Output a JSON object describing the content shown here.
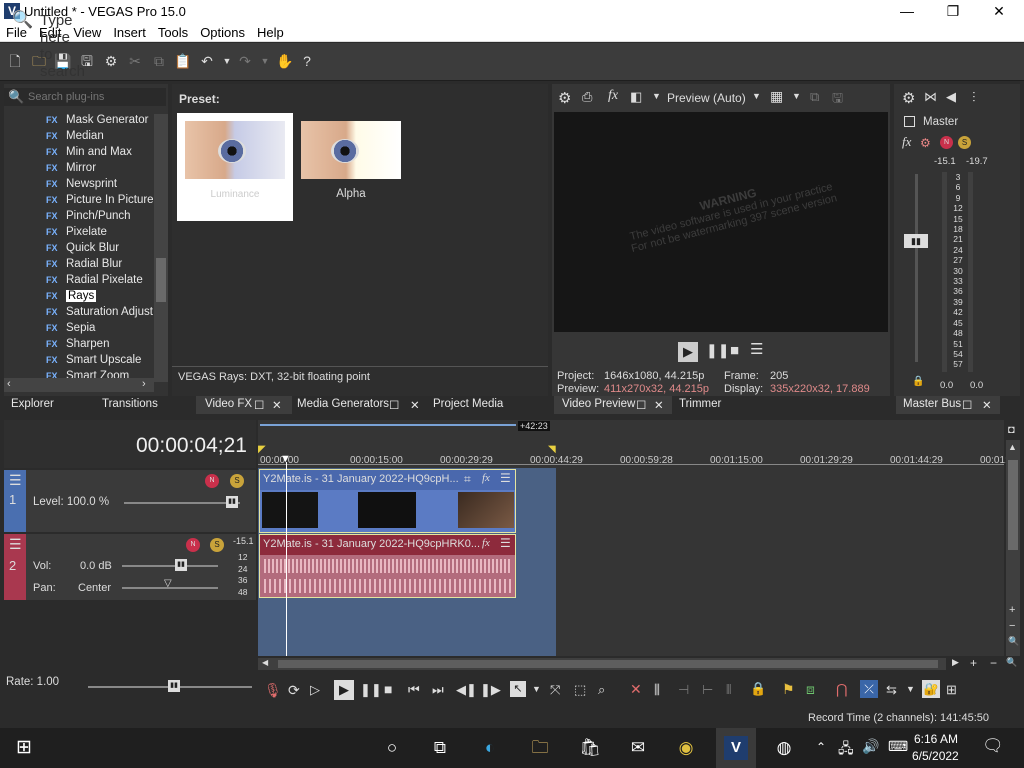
{
  "window": {
    "title": "Untitled * - VEGAS Pro 15.0",
    "logo_letter": "V",
    "minimize": "—",
    "maximize": "❐",
    "close": "✕"
  },
  "menu": [
    "File",
    "Edit",
    "View",
    "Insert",
    "Tools",
    "Options",
    "Help"
  ],
  "plugins": {
    "search_placeholder": "Search plug-ins",
    "items": [
      "Mask Generator",
      "Median",
      "Min and Max",
      "Mirror",
      "Newsprint",
      "Picture In Picture",
      "Pinch/Punch",
      "Pixelate",
      "Quick Blur",
      "Radial Blur",
      "Radial Pixelate",
      "Rays",
      "Saturation Adjust",
      "Sepia",
      "Sharpen",
      "Smart Upscale",
      "Smart Zoom"
    ],
    "selected": "Rays",
    "fx_tag": "FX"
  },
  "preset": {
    "header": "Preset:",
    "items": [
      "Luminance",
      "Alpha"
    ],
    "description": "VEGAS Rays: DXT, 32-bit floating point"
  },
  "preview": {
    "quality": "Preview (Auto)",
    "watermark_title": "WARNING",
    "watermark_line1": "The video software is used in your practice",
    "watermark_line2": "For not be watermarking 397 scene version",
    "project_label": "Project:",
    "project_value": "1646x1080, 44.215p",
    "frame_label": "Frame:",
    "frame_value": "205",
    "preview_label": "Preview:",
    "preview_value": "411x270x32, 44.215p",
    "display_label": "Display:",
    "display_value": "335x220x32, 17.889"
  },
  "master": {
    "label": "Master",
    "peak_left": "-15.1",
    "peak_right": "-19.7",
    "scale": [
      "3",
      "6",
      "9",
      "12",
      "15",
      "18",
      "21",
      "24",
      "27",
      "30",
      "33",
      "36",
      "39",
      "42",
      "45",
      "48",
      "51",
      "54",
      "57"
    ],
    "bottom_left": "0.0",
    "bottom_right": "0.0"
  },
  "tabs": {
    "explorer": "Explorer",
    "transitions": "Transitions",
    "video_fx": "Video FX",
    "media_generators": "Media Generators",
    "project_media": "Project Media",
    "video_preview": "Video Preview",
    "trimmer": "Trimmer",
    "master_bus": "Master Bus"
  },
  "timeline": {
    "timecode": "00:00:04;21",
    "offset_badge": "+42:23",
    "ruler": [
      "00:00:00",
      "00:00:15:00",
      "00:00:29:29",
      "00:00:44:29",
      "00:00:59:28",
      "00:01:15:00",
      "00:01:29:29",
      "00:01:44:29",
      "00:01:"
    ],
    "video_track": {
      "number": "1",
      "level": "Level: 100.0 %",
      "clip_title": "Y2Mate.is - 31 January 2022-HQ9cpH..."
    },
    "audio_track": {
      "number": "2",
      "vol_label": "Vol:",
      "vol_value": "0.0 dB",
      "pan_label": "Pan:",
      "pan_value": "Center",
      "peak": "-15.1",
      "meter": [
        "12",
        "24",
        "36",
        "48"
      ],
      "clip_title": "Y2Mate.is - 31 January 2022-HQ9cpHRK0..."
    },
    "rate": "Rate: 1.00"
  },
  "status": {
    "record_time": "Record Time (2 channels): 141:45:50"
  },
  "taskbar": {
    "search_placeholder": "Type here to search",
    "time": "6:16 AM",
    "date": "6/5/2022"
  },
  "colors": {
    "accent_blue": "#4a6184",
    "video_clip": "#5b7bc4",
    "audio_clip": "#b36b7d",
    "audio_clip_header": "#8d2a3c"
  }
}
